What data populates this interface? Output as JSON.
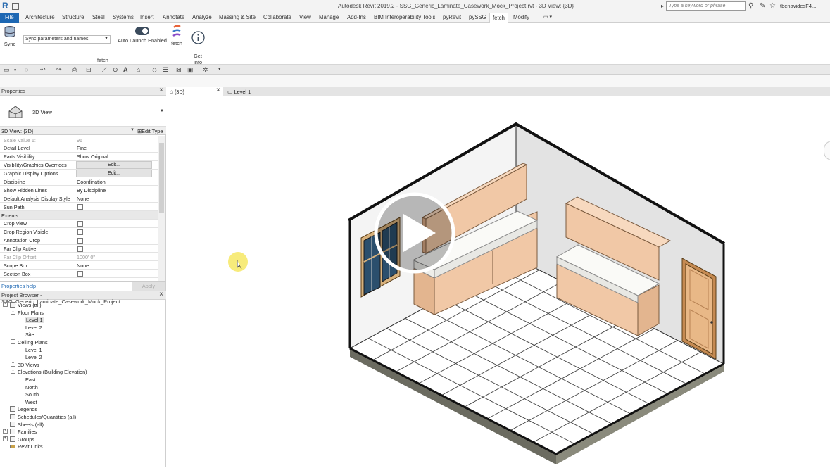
{
  "window": {
    "title": "Autodesk Revit 2019.2 - SSG_Generic_Laminate_Casework_Mock_Project.rvt - 3D View: {3D}",
    "search_placeholder": "Type a keyword or phrase",
    "user": "tbenavidesF4..."
  },
  "tabs": [
    {
      "label": "File"
    },
    {
      "label": "Architecture"
    },
    {
      "label": "Structure"
    },
    {
      "label": "Steel"
    },
    {
      "label": "Systems"
    },
    {
      "label": "Insert"
    },
    {
      "label": "Annotate"
    },
    {
      "label": "Analyze"
    },
    {
      "label": "Massing & Site"
    },
    {
      "label": "Collaborate"
    },
    {
      "label": "View"
    },
    {
      "label": "Manage"
    },
    {
      "label": "Add-Ins"
    },
    {
      "label": "BIM Interoperability Tools"
    },
    {
      "label": "pyRevit"
    },
    {
      "label": "pySSG"
    },
    {
      "label": "fetch"
    },
    {
      "label": "Modify"
    }
  ],
  "ribbon": {
    "sync_label": "Sync",
    "sync_select_value": "Sync parameters and names",
    "auto_launch_label": "Auto Launch Enabled",
    "fetch_label": "fetch",
    "get_info_label": "Get\nInfo",
    "panel_label": "fetch"
  },
  "properties": {
    "header": "Properties",
    "type_name": "3D View",
    "view_selector": "3D View: {3D}",
    "edit_type": "Edit Type",
    "rows": [
      {
        "key": "Scale Value    1:",
        "value": "96",
        "dim": true
      },
      {
        "key": "Detail Level",
        "value": "Fine"
      },
      {
        "key": "Parts Visibility",
        "value": "Show Original"
      },
      {
        "key": "Visibility/Graphics Overrides",
        "button": "Edit..."
      },
      {
        "key": "Graphic Display Options",
        "button": "Edit..."
      },
      {
        "key": "Discipline",
        "value": "Coordination"
      },
      {
        "key": "Show Hidden Lines",
        "value": "By Discipline"
      },
      {
        "key": "Default Analysis Display Style",
        "value": "None"
      },
      {
        "key": "Sun Path",
        "checkbox": true
      },
      {
        "key": "Extents",
        "category": true
      },
      {
        "key": "Crop View",
        "checkbox": true
      },
      {
        "key": "Crop Region Visible",
        "checkbox": true
      },
      {
        "key": "Annotation Crop",
        "checkbox": true
      },
      {
        "key": "Far Clip Active",
        "checkbox": true
      },
      {
        "key": "Far Clip Offset",
        "value": "1000'  0\"",
        "dim": true
      },
      {
        "key": "Scope Box",
        "value": "None"
      },
      {
        "key": "Section Box",
        "checkbox": true
      }
    ],
    "help_link": "Properties help",
    "apply": "Apply"
  },
  "browser": {
    "header": "Project Browser - SSG_Generic_Laminate_Casework_Mock_Project...",
    "nodes": [
      {
        "label": "Views (all)",
        "level": 0,
        "toggle": "-",
        "icon": "views"
      },
      {
        "label": "Floor Plans",
        "level": 1,
        "toggle": "-"
      },
      {
        "label": "Level 1",
        "level": 2,
        "selected": true
      },
      {
        "label": "Level 2",
        "level": 2
      },
      {
        "label": "Site",
        "level": 2
      },
      {
        "label": "Ceiling Plans",
        "level": 1,
        "toggle": "-"
      },
      {
        "label": "Level 1",
        "level": 2
      },
      {
        "label": "Level 2",
        "level": 2
      },
      {
        "label": "3D Views",
        "level": 1,
        "toggle": "+"
      },
      {
        "label": "Elevations (Building Elevation)",
        "level": 1,
        "toggle": "-"
      },
      {
        "label": "East",
        "level": 2
      },
      {
        "label": "North",
        "level": 2
      },
      {
        "label": "South",
        "level": 2
      },
      {
        "label": "West",
        "level": 2
      },
      {
        "label": "Legends",
        "level": 0,
        "icon": "box"
      },
      {
        "label": "Schedules/Quantities (all)",
        "level": 0,
        "icon": "box"
      },
      {
        "label": "Sheets (all)",
        "level": 0,
        "icon": "box"
      },
      {
        "label": "Families",
        "level": 0,
        "toggle": "+",
        "icon": "box"
      },
      {
        "label": "Groups",
        "level": 0,
        "toggle": "+",
        "icon": "box"
      },
      {
        "label": "Revit Links",
        "level": 0,
        "icon": "link"
      }
    ]
  },
  "view_tabs": [
    {
      "label": "{3D}",
      "active": true
    },
    {
      "label": "Level 1"
    }
  ],
  "colors": {
    "accent": "#1d67b3",
    "cabinet": "#f1c8a6",
    "floor_base": "#6b6b60",
    "door": "#e8b887"
  }
}
